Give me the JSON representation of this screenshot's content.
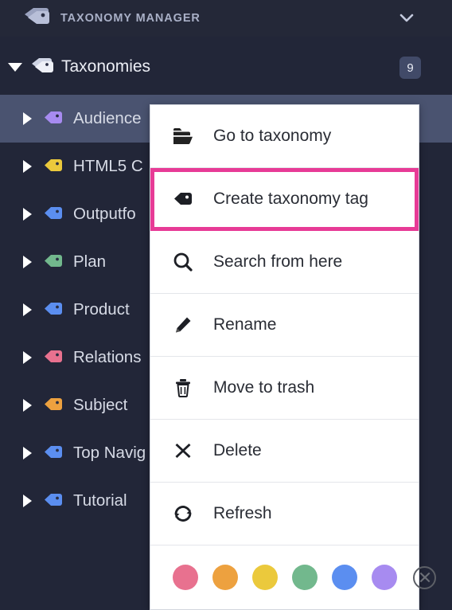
{
  "header": {
    "title": "TAXONOMY MANAGER",
    "logo_icon": "double-tag-icon",
    "collapse_icon": "chevron-down-icon"
  },
  "root": {
    "label": "Taxonomies",
    "count": "9",
    "expand_icon": "caret-down-icon",
    "tag_icon": "double-tag-icon"
  },
  "tree": {
    "items": [
      {
        "label": "Audience",
        "color": "#a78bf0",
        "selected": true
      },
      {
        "label": "HTML5 C",
        "color": "#ebc93c",
        "selected": false
      },
      {
        "label": "Outputfo",
        "color": "#5b8ef0",
        "selected": false
      },
      {
        "label": "Plan",
        "color": "#72b88d",
        "selected": false
      },
      {
        "label": "Product",
        "color": "#5b8ef0",
        "selected": false
      },
      {
        "label": "Relations",
        "color": "#e8718f",
        "selected": false
      },
      {
        "label": "Subject",
        "color": "#eda13f",
        "selected": false
      },
      {
        "label": "Top Navig",
        "color": "#5b8ef0",
        "selected": false
      },
      {
        "label": "Tutorial",
        "color": "#5b8ef0",
        "selected": false
      }
    ]
  },
  "context_menu": {
    "items": [
      {
        "label": "Go to taxonomy",
        "icon": "folder-open-icon",
        "highlighted": false
      },
      {
        "label": "Create taxonomy tag",
        "icon": "tag-icon",
        "highlighted": true
      },
      {
        "label": "Search from here",
        "icon": "search-icon",
        "highlighted": false
      },
      {
        "label": "Rename",
        "icon": "pencil-icon",
        "highlighted": false
      },
      {
        "label": "Move to trash",
        "icon": "trash-icon",
        "highlighted": false
      },
      {
        "label": "Delete",
        "icon": "close-x-icon",
        "highlighted": false
      },
      {
        "label": "Refresh",
        "icon": "refresh-icon",
        "highlighted": false
      }
    ],
    "highlight_color": "#e73b96",
    "swatches": [
      {
        "name": "swatch-pink",
        "color": "#e8718f"
      },
      {
        "name": "swatch-orange",
        "color": "#eda13f"
      },
      {
        "name": "swatch-yellow",
        "color": "#ebc93c"
      },
      {
        "name": "swatch-green",
        "color": "#72b88d"
      },
      {
        "name": "swatch-blue",
        "color": "#5b8ef0"
      },
      {
        "name": "swatch-purple",
        "color": "#a78bf0"
      }
    ],
    "clear_color_icon": "clear-color-icon"
  },
  "theme": {
    "background": "#222638",
    "header_background": "#242838",
    "selected_row": "#4a5370",
    "badge_background": "#414a68",
    "menu_background": "#ffffff"
  }
}
